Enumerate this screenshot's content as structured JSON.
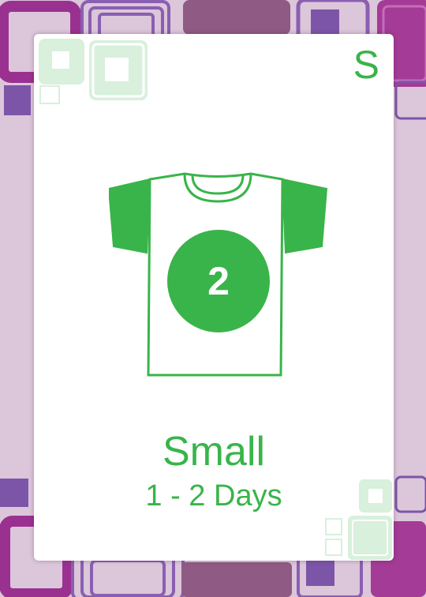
{
  "card": {
    "corner_letter": "S",
    "shirt_number": "2",
    "size_name": "Small",
    "duration": "1 - 2 Days"
  },
  "colors": {
    "accent_green": "#39b44a",
    "pale_green": "#d8f0dc",
    "purple_dark": "#9a3191",
    "purple_mid": "#7d55a8",
    "lilac": "#dcc6da"
  },
  "icons": [
    "tshirt-icon"
  ]
}
